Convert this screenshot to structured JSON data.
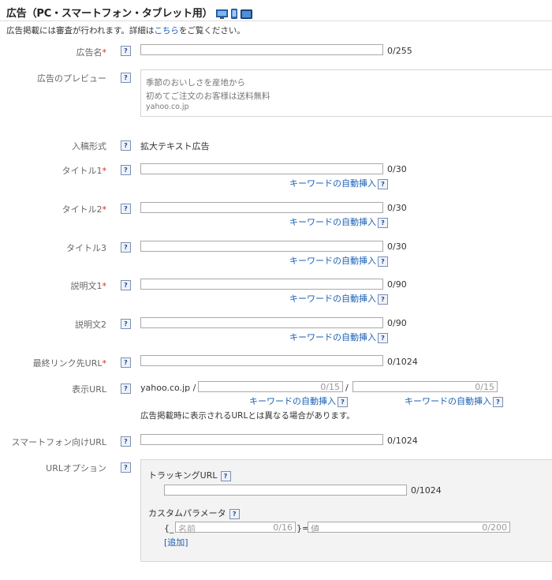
{
  "header": {
    "title": "広告（PC・スマートフォン・タブレット用）",
    "notice_prefix": "広告掲載には審査が行われます。詳細は",
    "notice_link": "こちら",
    "notice_suffix": "をご覧ください。",
    "device_icons": [
      "desktop-icon",
      "smartphone-icon",
      "tablet-icon"
    ]
  },
  "help_glyph": "?",
  "required_mark": "*",
  "fields": {
    "ad_name": {
      "label": "広告名",
      "counter": "0/255"
    },
    "preview": {
      "label": "広告のプレビュー",
      "line1": "季節のおいしさを産地から",
      "line2": "初めてご注文のお客様は送料無料",
      "line3": "yahoo.co.jp"
    },
    "format": {
      "label": "入稿形式",
      "value": "拡大テキスト広告"
    },
    "title1": {
      "label": "タイトル1",
      "counter": "0/30"
    },
    "title2": {
      "label": "タイトル2",
      "counter": "0/30"
    },
    "title3": {
      "label": "タイトル3",
      "counter": "0/30"
    },
    "desc1": {
      "label": "説明文1",
      "counter": "0/90"
    },
    "desc2": {
      "label": "説明文2",
      "counter": "0/90"
    },
    "final_url": {
      "label": "最終リンク先URL",
      "counter": "0/1024"
    },
    "display_url": {
      "label": "表示URL",
      "domain": "yahoo.co.jp",
      "sep": "/",
      "path1_counter": "0/15",
      "path2_counter": "0/15",
      "note": "広告掲載時に表示されるURLとは異なる場合があります。"
    },
    "smartphone_url": {
      "label": "スマートフォン向けURL",
      "counter": "0/1024"
    },
    "url_options": {
      "label": "URLオプション",
      "tracking_label": "トラッキングURL",
      "tracking_counter": "0/1024",
      "custom_label": "カスタムパラメータ",
      "brace_open": "{_",
      "brace_close": "}=",
      "name_placeholder": "名前",
      "name_counter": "0/16",
      "value_placeholder": "値",
      "value_counter": "0/200",
      "add_link": "[追加]"
    }
  },
  "keyword_insert": "キーワードの自動挿入"
}
